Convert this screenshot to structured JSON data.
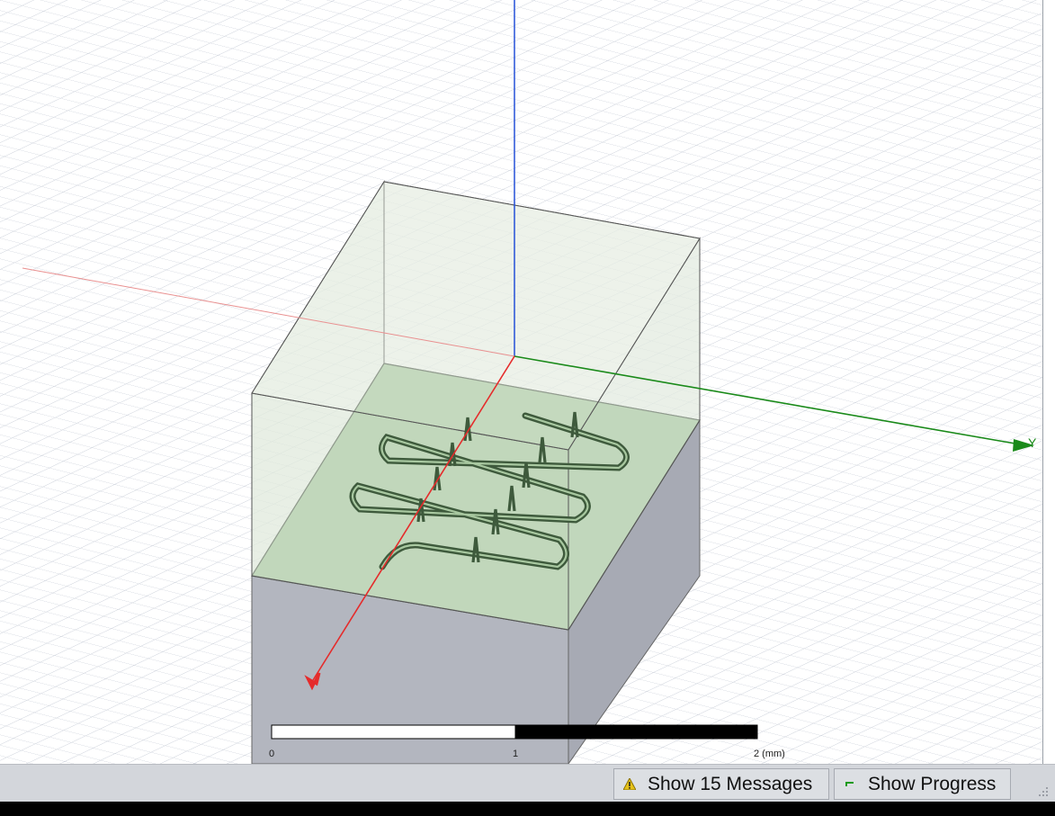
{
  "viewport": {
    "axis_y_label": "Y",
    "scale_bar": {
      "tick_labels": [
        "0",
        "1",
        "2 (mm)"
      ]
    }
  },
  "statusbar": {
    "messages_button": {
      "label": "Show 15 Messages",
      "icon": "warning-icon"
    },
    "progress_button": {
      "label": "Show Progress",
      "icon": "progress-icon"
    }
  },
  "colors": {
    "x_axis": "#e52b2b",
    "y_axis": "#1a8a1a",
    "z_axis": "#2550d8",
    "substrate_top": "#a8c8a0",
    "substrate_side": "#b3b6bf",
    "trace": "#5a7a55"
  }
}
